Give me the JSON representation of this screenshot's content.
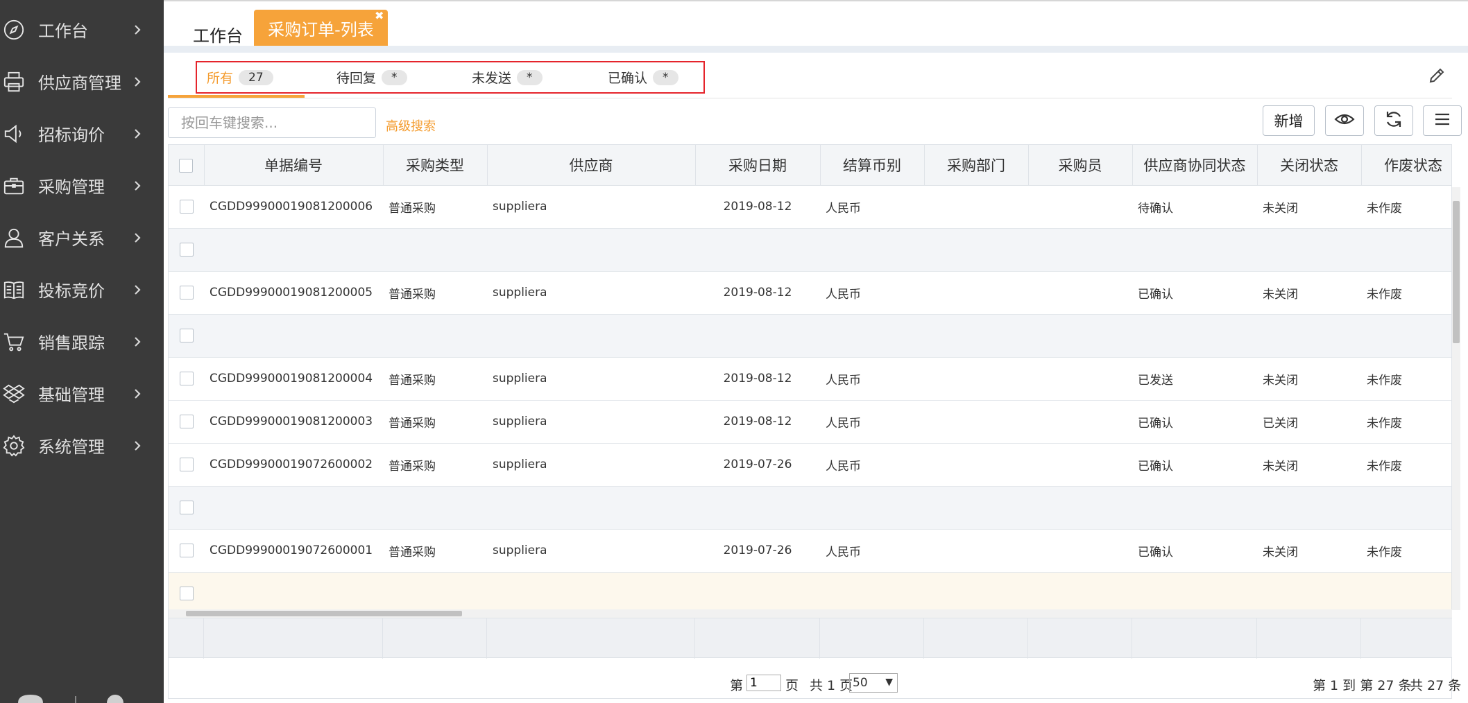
{
  "sidebar": {
    "items": [
      {
        "label": "工作台",
        "icon": "compass-icon"
      },
      {
        "label": "供应商管理",
        "icon": "printer-icon"
      },
      {
        "label": "招标询价",
        "icon": "megaphone-icon"
      },
      {
        "label": "采购管理",
        "icon": "briefcase-icon"
      },
      {
        "label": "客户关系",
        "icon": "user-icon"
      },
      {
        "label": "投标竞价",
        "icon": "book-icon"
      },
      {
        "label": "销售跟踪",
        "icon": "cart-icon"
      },
      {
        "label": "基础管理",
        "icon": "dropbox-icon"
      },
      {
        "label": "系统管理",
        "icon": "gear-icon"
      }
    ]
  },
  "tabs": {
    "home": "工作台",
    "active": "采购订单-列表",
    "close": "✖"
  },
  "filters": [
    {
      "label": "所有",
      "count": "27"
    },
    {
      "label": "待回复",
      "count": "*"
    },
    {
      "label": "未发送",
      "count": "*"
    },
    {
      "label": "已确认",
      "count": "*"
    }
  ],
  "toolbar": {
    "search_placeholder": "按回车键搜索...",
    "advanced_search": "高级搜索",
    "new_label": "新增"
  },
  "table": {
    "headers": [
      "单据编号",
      "采购类型",
      "供应商",
      "采购日期",
      "结算币别",
      "采购部门",
      "采购员",
      "供应商协同状态",
      "关闭状态",
      "作废状态"
    ],
    "rows": [
      {
        "no": "CGDD99900019081200006",
        "type": "普通采购",
        "supplier": "suppliera",
        "date": "2019-08-12",
        "currency": "人民币",
        "dept": "",
        "buyer": "",
        "collab": "待确认",
        "close": "未关闭",
        "void": "未作废"
      },
      {
        "no": "",
        "type": "",
        "supplier": "",
        "date": "",
        "currency": "",
        "dept": "",
        "buyer": "",
        "collab": "",
        "close": "",
        "void": ""
      },
      {
        "no": "CGDD99900019081200005",
        "type": "普通采购",
        "supplier": "suppliera",
        "date": "2019-08-12",
        "currency": "人民币",
        "dept": "",
        "buyer": "",
        "collab": "已确认",
        "close": "未关闭",
        "void": "未作废"
      },
      {
        "no": "",
        "type": "",
        "supplier": "",
        "date": "",
        "currency": "",
        "dept": "",
        "buyer": "",
        "collab": "",
        "close": "",
        "void": ""
      },
      {
        "no": "CGDD99900019081200004",
        "type": "普通采购",
        "supplier": "suppliera",
        "date": "2019-08-12",
        "currency": "人民币",
        "dept": "",
        "buyer": "",
        "collab": "已发送",
        "close": "未关闭",
        "void": "未作废"
      },
      {
        "no": "CGDD99900019081200003",
        "type": "普通采购",
        "supplier": "suppliera",
        "date": "2019-08-12",
        "currency": "人民币",
        "dept": "",
        "buyer": "",
        "collab": "已确认",
        "close": "已关闭",
        "void": "未作废"
      },
      {
        "no": "CGDD99900019072600002",
        "type": "普通采购",
        "supplier": "suppliera",
        "date": "2019-07-26",
        "currency": "人民币",
        "dept": "",
        "buyer": "",
        "collab": "已确认",
        "close": "未关闭",
        "void": "未作废"
      },
      {
        "no": "",
        "type": "",
        "supplier": "",
        "date": "",
        "currency": "",
        "dept": "",
        "buyer": "",
        "collab": "",
        "close": "",
        "void": ""
      },
      {
        "no": "CGDD99900019072600001",
        "type": "普通采购",
        "supplier": "suppliera",
        "date": "2019-07-26",
        "currency": "人民币",
        "dept": "",
        "buyer": "",
        "collab": "已确认",
        "close": "未关闭",
        "void": "未作废"
      },
      {
        "no": "",
        "type": "",
        "supplier": "",
        "date": "",
        "currency": "",
        "dept": "",
        "buyer": "",
        "collab": "",
        "close": "",
        "void": ""
      }
    ]
  },
  "pager": {
    "page_prefix": "第",
    "page_value": "1",
    "page_suffix": "页",
    "total_pages": "共 1 页",
    "page_size": "50",
    "range": "第 1 到 第 27 条",
    "total": "共 27 条"
  },
  "colors": {
    "accent": "#f6a33a",
    "sidebar_bg": "#3a3a3a",
    "highlight_box": "#e5242b"
  }
}
